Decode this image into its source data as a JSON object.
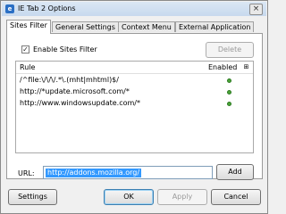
{
  "window": {
    "title": "IE Tab 2 Options",
    "close_glyph": "×"
  },
  "tabs": [
    {
      "label": "Sites Filter",
      "active": true
    },
    {
      "label": "General Settings",
      "active": false
    },
    {
      "label": "Context Menu",
      "active": false
    },
    {
      "label": "External Application",
      "active": false
    }
  ],
  "sites_filter": {
    "enable_label": "Enable Sites Filter",
    "enable_checked": true,
    "delete_label": "Delete",
    "columns": {
      "rule": "Rule",
      "enabled": "Enabled",
      "column_icon": "column-chooser-icon"
    },
    "rules": [
      {
        "rule": "/^file:\\/\\/\\/.*\\.(mht|mhtml)$/",
        "enabled": true
      },
      {
        "rule": "http://*update.microsoft.com/*",
        "enabled": true
      },
      {
        "rule": "http://www.windowsupdate.com/*",
        "enabled": true
      }
    ],
    "url_label": "URL:",
    "url_value": "http://addons.mozilla.org/",
    "add_label": "Add"
  },
  "footer": {
    "settings_label": "Settings",
    "ok_label": "OK",
    "apply_label": "Apply",
    "cancel_label": "Cancel"
  },
  "colors": {
    "accent": "#3399ff",
    "enabled_dot": "#4aa438"
  }
}
